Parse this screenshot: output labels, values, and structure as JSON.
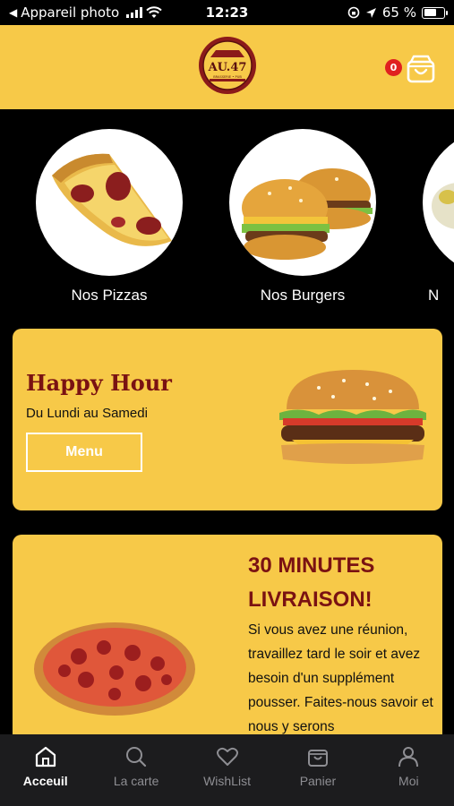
{
  "status_bar": {
    "back_label": "Appareil photo",
    "time": "12:23",
    "battery_percent": "65 %",
    "battery_level": 0.65
  },
  "header": {
    "logo_text": "AU.47",
    "logo_subtext": "BRASSERIE • PUB",
    "cart_count": "0"
  },
  "categories": [
    {
      "label": "Nos Pizzas"
    },
    {
      "label": "Nos Burgers"
    },
    {
      "label": "N"
    }
  ],
  "happy_hour": {
    "title": "Happy Hour",
    "subtitle": "Du Lundi au Samedi",
    "button_label": "Menu"
  },
  "delivery": {
    "title": "30 MINUTES LIVRAISON!",
    "text": "Si vous avez une réunion, travaillez tard le soir et avez besoin d'un supplément pousser. Faites-nous savoir et nous y serons"
  },
  "bottom_nav": [
    {
      "label": "Acceuil",
      "icon": "home-icon",
      "active": true
    },
    {
      "label": "La carte",
      "icon": "search-icon",
      "active": false
    },
    {
      "label": "WishList",
      "icon": "heart-icon",
      "active": false
    },
    {
      "label": "Panier",
      "icon": "bag-icon",
      "active": false
    },
    {
      "label": "Moi",
      "icon": "user-icon",
      "active": false
    }
  ],
  "colors": {
    "accent": "#f7c948",
    "title_red": "#7a1212",
    "nav_bg": "#1c1c1e"
  }
}
